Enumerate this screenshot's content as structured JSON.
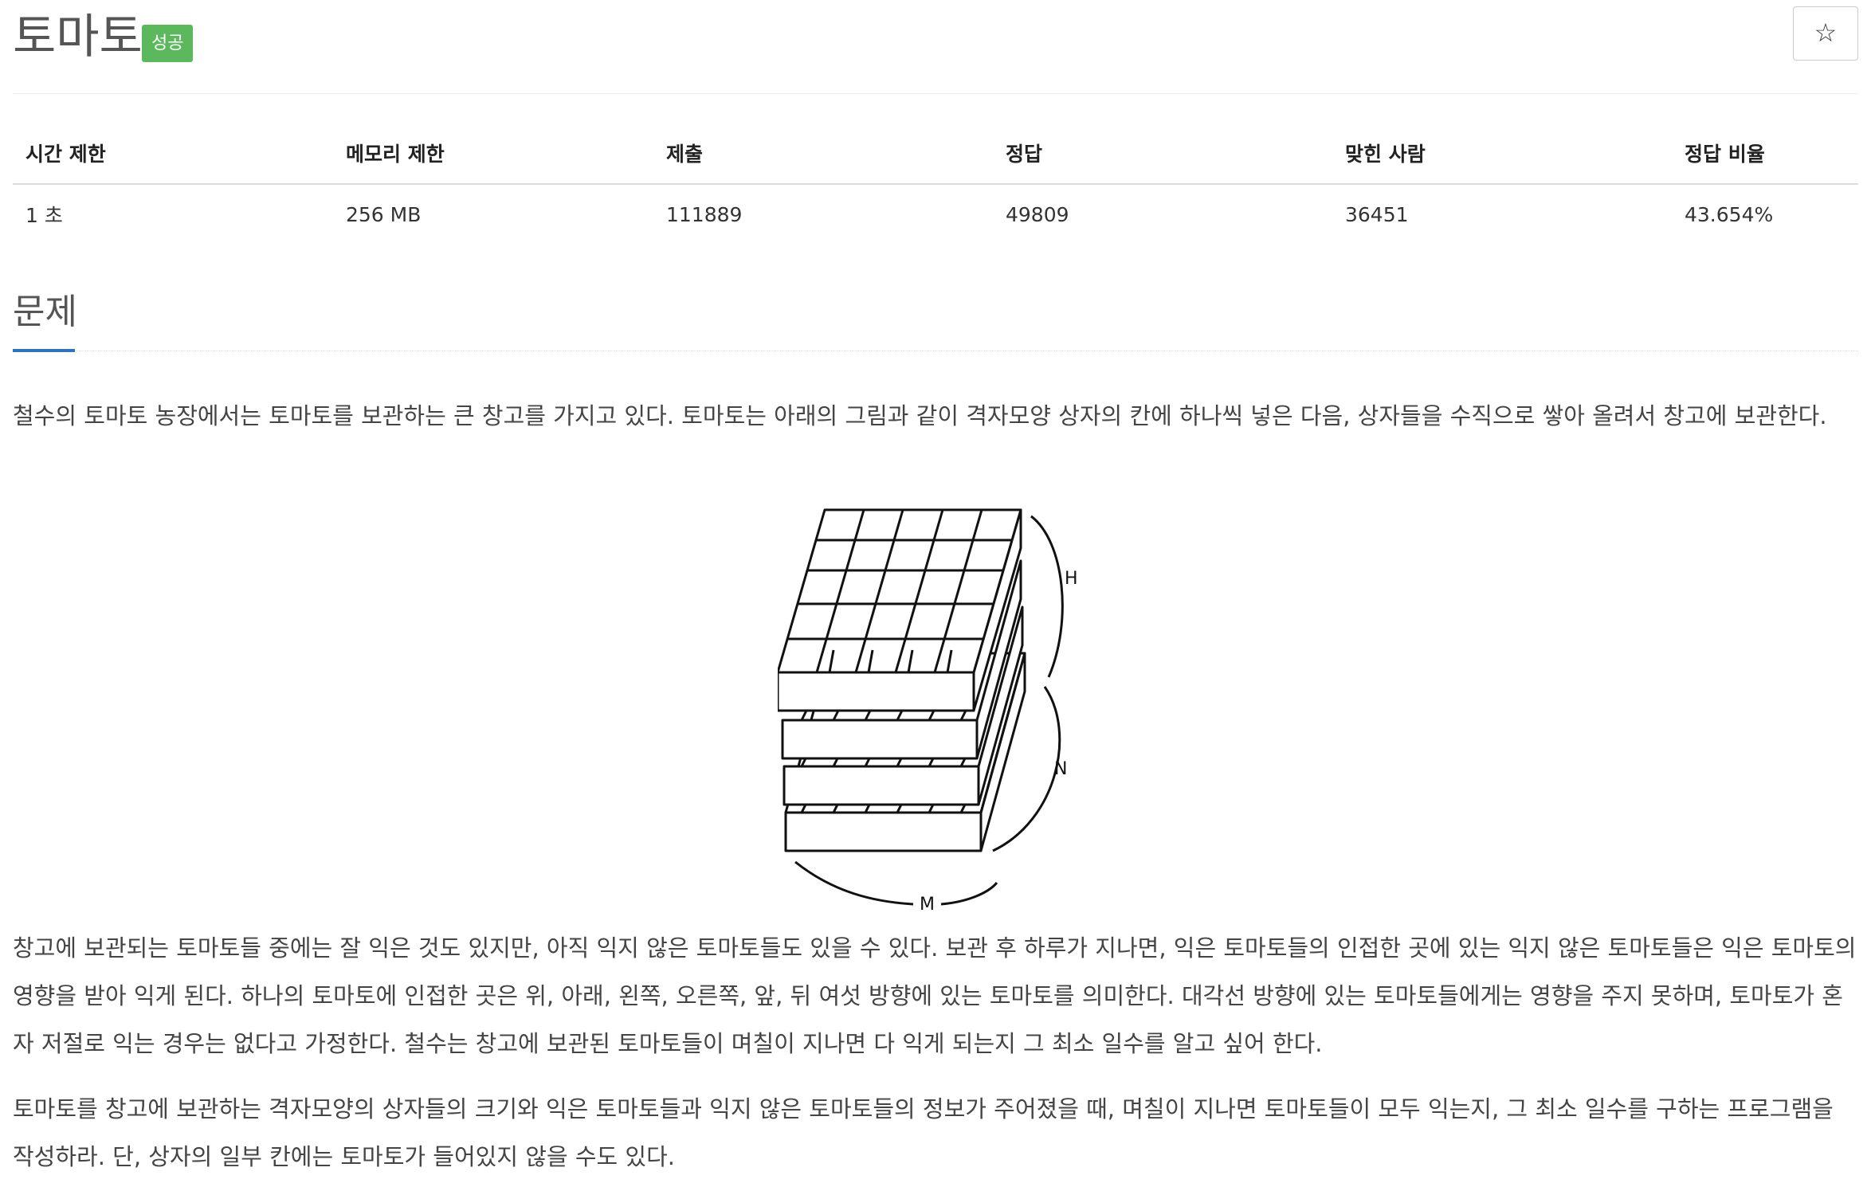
{
  "problem": {
    "title": "토마토",
    "status_badge": "성공",
    "star_icon": "☆"
  },
  "stats": {
    "headers": [
      "시간 제한",
      "메모리 제한",
      "제출",
      "정답",
      "맞힌 사람",
      "정답 비율"
    ],
    "values": [
      "1 초",
      "256 MB",
      "111889",
      "49809",
      "36451",
      "43.654%"
    ]
  },
  "section": {
    "title": "문제",
    "paragraph1": "철수의 토마토 농장에서는 토마토를 보관하는 큰 창고를 가지고 있다. 토마토는 아래의 그림과 같이 격자모양 상자의 칸에 하나씩 넣은 다음, 상자들을 수직으로 쌓아 올려서 창고에 보관한다.",
    "figure_labels": {
      "h": "H",
      "n": "N",
      "m": "M"
    },
    "paragraph2": "창고에 보관되는 토마토들 중에는 잘 익은 것도 있지만, 아직 익지 않은 토마토들도 있을 수 있다. 보관 후 하루가 지나면, 익은 토마토들의 인접한 곳에 있는 익지 않은 토마토들은 익은 토마토의 영향을 받아 익게 된다. 하나의 토마토에 인접한 곳은 위, 아래, 왼쪽, 오른쪽, 앞, 뒤 여섯 방향에 있는 토마토를 의미한다. 대각선 방향에 있는 토마토들에게는 영향을 주지 못하며, 토마토가 혼자 저절로 익는 경우는 없다고 가정한다. 철수는 창고에 보관된 토마토들이 며칠이 지나면 다 익게 되는지 그 최소 일수를 알고 싶어 한다.",
    "paragraph3": "토마토를 창고에 보관하는 격자모양의 상자들의 크기와 익은 토마토들과 익지 않은 토마토들의 정보가 주어졌을 때, 며칠이 지나면 토마토들이 모두 익는지, 그 최소 일수를 구하는 프로그램을 작성하라. 단, 상자의 일부 칸에는 토마토가 들어있지 않을 수도 있다."
  }
}
